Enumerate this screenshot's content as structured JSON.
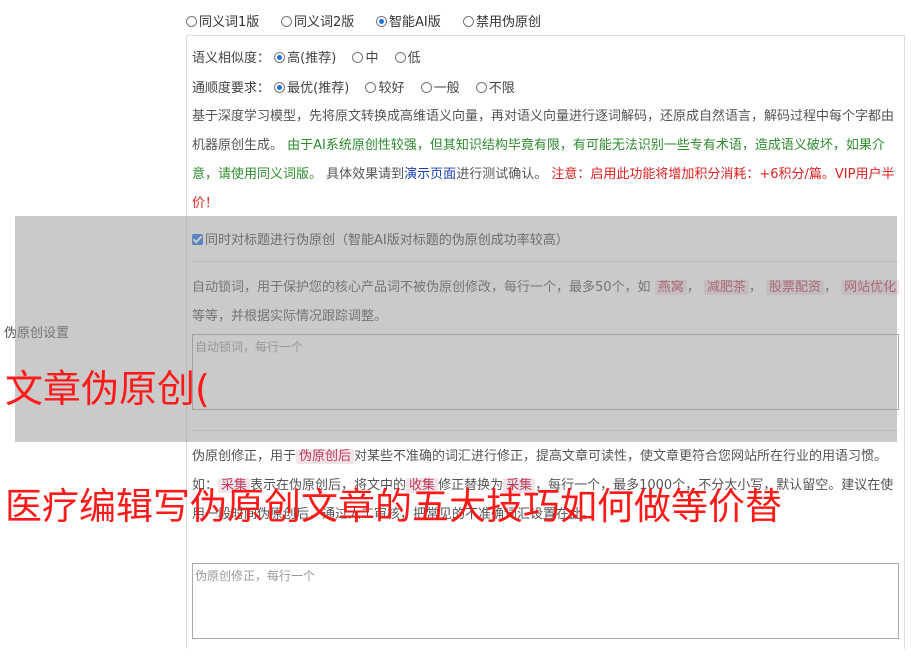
{
  "top_options": [
    {
      "label": "同义词1版",
      "selected": false
    },
    {
      "label": "同义词2版",
      "selected": false
    },
    {
      "label": "智能AI版",
      "selected": true
    },
    {
      "label": "禁用伪原创",
      "selected": false
    }
  ],
  "similarity": {
    "label": "语义相似度：",
    "options": [
      "高(推荐)",
      "中",
      "低"
    ],
    "selected": 0
  },
  "fluency": {
    "label": "通顺度要求：",
    "options": [
      "最优(推荐)",
      "较好",
      "一般",
      "不限"
    ],
    "selected": 0
  },
  "description": {
    "p1": "基于深度学习模型，先将原文转换成高维语义向量，再对语义向量进行逐词解码，还原成自然语言，解码过程中每个字都由机器原创生成。",
    "p2": "由于AI系统原创性较强，但其知识结构毕竟有限，有可能无法识别一些专有术语，造成语义破坏，如果介意，请使用同义词版。",
    "p3": "具体效果请到",
    "link": "演示页面",
    "p4": "进行测试确认。",
    "p5": "注意：启用此功能将增加积分消耗：+6积分/篇。VIP用户半价！"
  },
  "title_checkbox": {
    "label": "同时对标题进行伪原创（智能AI版对标题的伪原创成功率较高）",
    "checked": true
  },
  "side_label": "伪原创设置",
  "lock_words": {
    "text1": "自动锁词，用于保护您的核心产品词不被伪原创修改，每行一个，最多50个，如",
    "tags": [
      "燕窝",
      "减肥茶",
      "股票配资",
      "网站优化"
    ],
    "text2": "等等，并根据实际情况跟踪调整。",
    "placeholder": "自动锁词，每行一个"
  },
  "correction": {
    "text1": "伪原创修正，用于",
    "tag": "伪原创后",
    "text2": "对某些不准确的词汇进行修正，提高文章可读性，使文章更符合您网站所在行业的用语习惯。如：",
    "text3": "采集",
    "text4": "表示在伪原创后，将文中的",
    "text5": "收集",
    "text6": "修正替换为",
    "text7": "采集",
    "text8": "，",
    "text9": "每行一个，最多1000个，不分大小写，默认留空。建议在使用一段时间伪原创后，通过人工审核，把常见的不准确词汇设置在此。",
    "placeholder": "伪原创修正，每行一个"
  },
  "overlay_text": {
    "line1": "文章伪原创(",
    "line2": "医疗编辑写伪原创文章的五大技巧如何做等价替"
  }
}
